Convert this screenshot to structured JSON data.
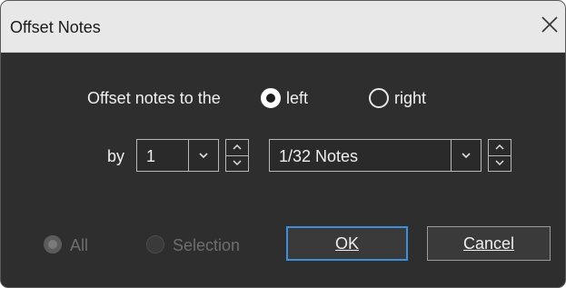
{
  "dialog": {
    "title": "Offset Notes",
    "close_icon": "close-icon"
  },
  "direction": {
    "prompt": "Offset notes to the",
    "selected": "left",
    "options": [
      {
        "label": "left",
        "checked": true
      },
      {
        "label": "right",
        "checked": false
      }
    ]
  },
  "amount": {
    "by_label": "by",
    "count_value": "1",
    "unit_value": "1/32 Notes",
    "dropdown_icon": "chevron-down-icon",
    "stepper_up_icon": "chevron-up-icon",
    "stepper_down_icon": "chevron-down-icon"
  },
  "scope": {
    "selected": "All",
    "disabled": true,
    "options": [
      {
        "label": "All",
        "checked": true
      },
      {
        "label": "Selection",
        "checked": false
      }
    ]
  },
  "buttons": {
    "ok_label": "OK",
    "cancel_label": "Cancel"
  },
  "colors": {
    "background": "#2e2e2e",
    "titlebar": "#e8e8e8",
    "focus_accent": "#3c8fd8",
    "text": "#f0f0f0",
    "disabled_text": "#6e6e6e"
  }
}
